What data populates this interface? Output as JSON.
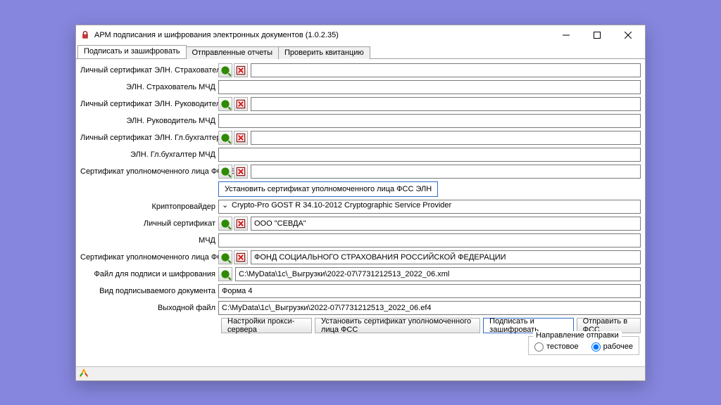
{
  "title": "АРМ подписания и шифрования электронных документов (1.0.2.35)",
  "tabs": {
    "sign": "Подписать и зашифровать",
    "sent": "Отправленные отчеты",
    "check": "Проверить квитанцию"
  },
  "labels": {
    "cert_eln_insurer": "Личный сертификат ЭЛН. Страхователь",
    "eln_insurer_mchd": "ЭЛН. Страхователь МЧД",
    "cert_eln_head": "Личный сертификат ЭЛН. Руководитель",
    "eln_head_mchd": "ЭЛН. Руководитель МЧД",
    "cert_eln_acc": "Личный сертификат ЭЛН. Гл.бухгалтер",
    "eln_acc_mchd": "ЭЛН. Гл.бухгалтер МЧД",
    "cert_auth_fss_eln": "Сертификат уполномоченного лица ФСС ЭЛН",
    "install_cert_fss_eln": "Установить сертификат уполномоченного лица ФСС ЭЛН",
    "cryptoprovider": "Криптопровайдер",
    "personal_cert": "Личный сертификат",
    "mchd": "МЧД",
    "cert_auth_fss": "Сертификат уполномоченного лица ФСС",
    "file_to_sign": "Файл для подписи и шифрования",
    "doc_type": "Вид подписываемого документа",
    "out_file": "Выходной файл"
  },
  "values": {
    "cryptoprovider": "Crypto-Pro GOST R 34.10-2012 Cryptographic Service Provider",
    "personal_cert": "ООО \"СЕВДА\"",
    "cert_auth_fss": "ФОНД СОЦИАЛЬНОГО СТРАХОВАНИЯ РОССИЙСКОЙ ФЕДЕРАЦИИ",
    "file_to_sign": "C:\\MyData\\1c\\_Выгрузки\\2022-07\\7731212513_2022_06.xml",
    "doc_type": "Форма 4",
    "out_file": "C:\\MyData\\1c\\_Выгрузки\\2022-07\\7731212513_2022_06.ef4"
  },
  "buttons": {
    "proxy": "Настройки прокси-сервера",
    "install_fss": "Установить сертификат уполномоченного лица ФСС",
    "sign_encrypt": "Подписать и зашифровать",
    "send_fss": "Отправить в ФСС"
  },
  "group": {
    "legend": "Направление отправки",
    "test": "тестовое",
    "work": "рабочее"
  }
}
